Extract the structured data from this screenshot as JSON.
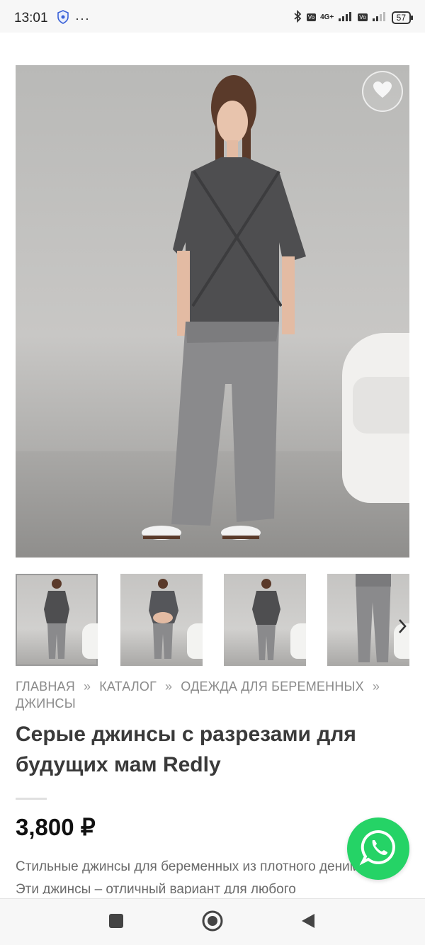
{
  "status_bar": {
    "time": "13:01",
    "dots": "···",
    "network": "4G+",
    "battery": "57"
  },
  "product": {
    "title": "Серые джинсы с разрезами для будущих мам Redly",
    "price": "3,800 ₽",
    "description": "Стильные джинсы для беременных из плотного денима. Эти джинсы – отличный вариант для любого"
  },
  "breadcrumb": [
    {
      "label": "ГЛАВНАЯ"
    },
    {
      "label": "КАТАЛОГ"
    },
    {
      "label": "ОДЕЖДА ДЛЯ БЕРЕМЕННЫХ"
    },
    {
      "label": "ДЖИНСЫ"
    }
  ],
  "breadcrumb_separator": "»",
  "gallery": {
    "thumbnail_count": 4,
    "active_thumbnail": 1
  },
  "icons": {
    "favorite": "heart-icon",
    "prev": "chevron-left-icon",
    "next": "chevron-right-icon",
    "chat": "whatsapp-icon",
    "nav": [
      "square-icon",
      "circle-home-icon",
      "triangle-back-icon"
    ]
  },
  "colors": {
    "whatsapp": "#25d366",
    "title": "#3a3a3a",
    "breadcrumb": "#8a8a8a"
  }
}
